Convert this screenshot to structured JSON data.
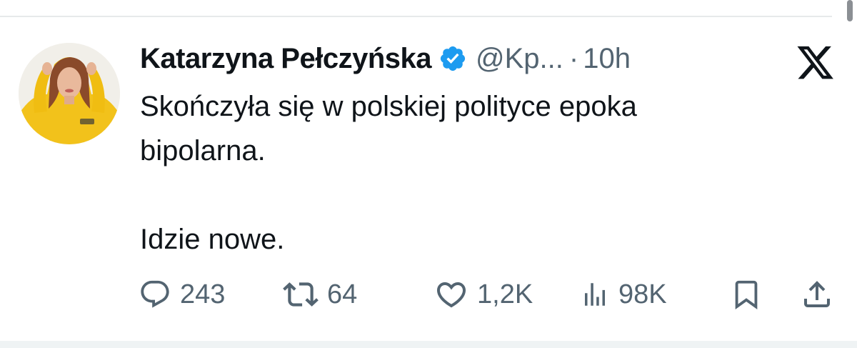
{
  "tweet": {
    "display_name": "Katarzyna Pełczyńska",
    "handle": "@Kp...",
    "separator": "·",
    "time": "10h",
    "text_line1": "Skończyła się w polskiej polityce epoka",
    "text_line2": "bipolarna.",
    "text_line3": "Idzie nowe."
  },
  "stats": {
    "replies": "243",
    "retweets": "64",
    "likes": "1,2K",
    "views": "98K"
  },
  "icons": {
    "verified": "verified-badge-icon",
    "platform": "x-logo-icon",
    "reply": "reply-icon",
    "retweet": "retweet-icon",
    "like": "heart-icon",
    "views": "views-icon",
    "bookmark": "bookmark-icon",
    "share": "share-icon"
  },
  "colors": {
    "verified": "#1d9bf0",
    "text": "#0f1419",
    "secondary": "#536471",
    "avatar_hoodie": "#f2c21b"
  }
}
